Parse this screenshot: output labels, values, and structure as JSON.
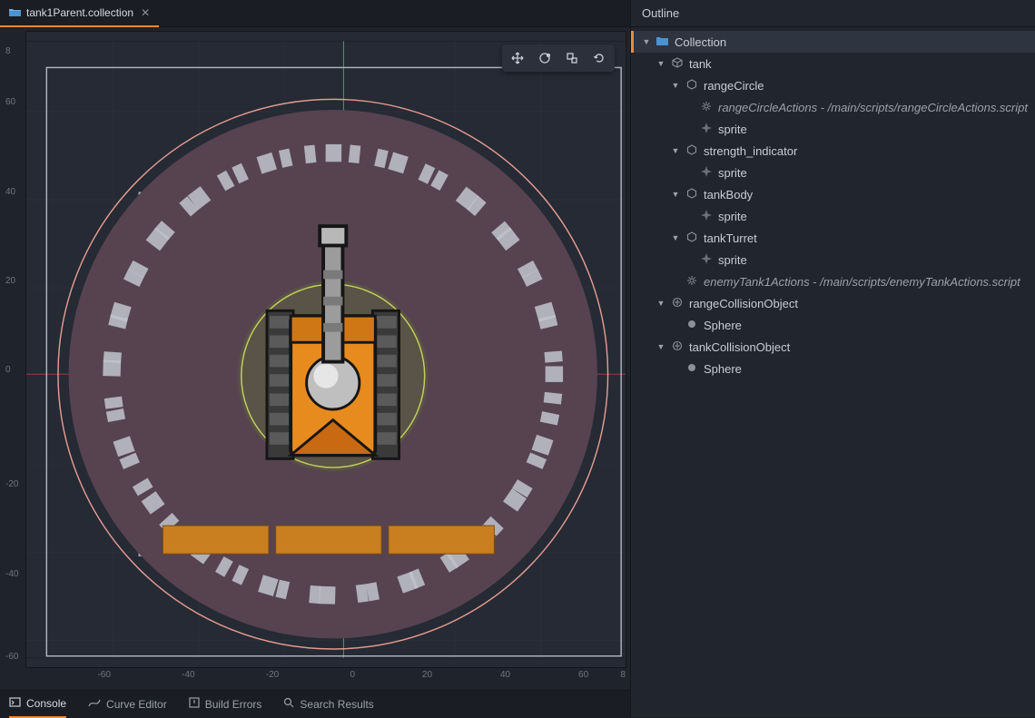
{
  "tab": {
    "title": "tank1Parent.collection"
  },
  "axis_x": [
    "-60",
    "-40",
    "-20",
    "0",
    "20",
    "40",
    "60",
    "8"
  ],
  "axis_y": [
    "-60",
    "-40",
    "-20",
    "0",
    "20",
    "40",
    "60",
    "8"
  ],
  "toolbar": {
    "move": "move-tool",
    "rotate": "rotate-tool",
    "scale": "scale-tool",
    "refresh": "refresh-tool"
  },
  "bottom": {
    "console": "Console",
    "curve": "Curve Editor",
    "build": "Build Errors",
    "search": "Search Results"
  },
  "outline": {
    "title": "Outline",
    "tree": [
      {
        "depth": 0,
        "arrow": "▼",
        "icon": "collection",
        "label": "Collection",
        "selected": true
      },
      {
        "depth": 1,
        "arrow": "▼",
        "icon": "cube",
        "label": "tank"
      },
      {
        "depth": 2,
        "arrow": "▼",
        "icon": "hex",
        "label": "rangeCircle"
      },
      {
        "depth": 3,
        "arrow": "",
        "icon": "gear",
        "label": "rangeCircleActions - /main/scripts/rangeCircleActions.script",
        "italic": true
      },
      {
        "depth": 3,
        "arrow": "",
        "icon": "sprite",
        "label": "sprite"
      },
      {
        "depth": 2,
        "arrow": "▼",
        "icon": "hex",
        "label": "strength_indicator"
      },
      {
        "depth": 3,
        "arrow": "",
        "icon": "sprite",
        "label": "sprite"
      },
      {
        "depth": 2,
        "arrow": "▼",
        "icon": "hex",
        "label": "tankBody"
      },
      {
        "depth": 3,
        "arrow": "",
        "icon": "sprite",
        "label": "sprite"
      },
      {
        "depth": 2,
        "arrow": "▼",
        "icon": "hex",
        "label": "tankTurret"
      },
      {
        "depth": 3,
        "arrow": "",
        "icon": "sprite",
        "label": "sprite"
      },
      {
        "depth": 2,
        "arrow": "",
        "icon": "gear",
        "label": "enemyTank1Actions - /main/scripts/enemyTankActions.script",
        "italic": true
      },
      {
        "depth": 1,
        "arrow": "▼",
        "icon": "collision",
        "label": "rangeCollisionObject"
      },
      {
        "depth": 2,
        "arrow": "",
        "icon": "circle",
        "label": "Sphere"
      },
      {
        "depth": 1,
        "arrow": "▼",
        "icon": "collision",
        "label": "tankCollisionObject"
      },
      {
        "depth": 2,
        "arrow": "",
        "icon": "circle",
        "label": "Sphere"
      }
    ]
  }
}
